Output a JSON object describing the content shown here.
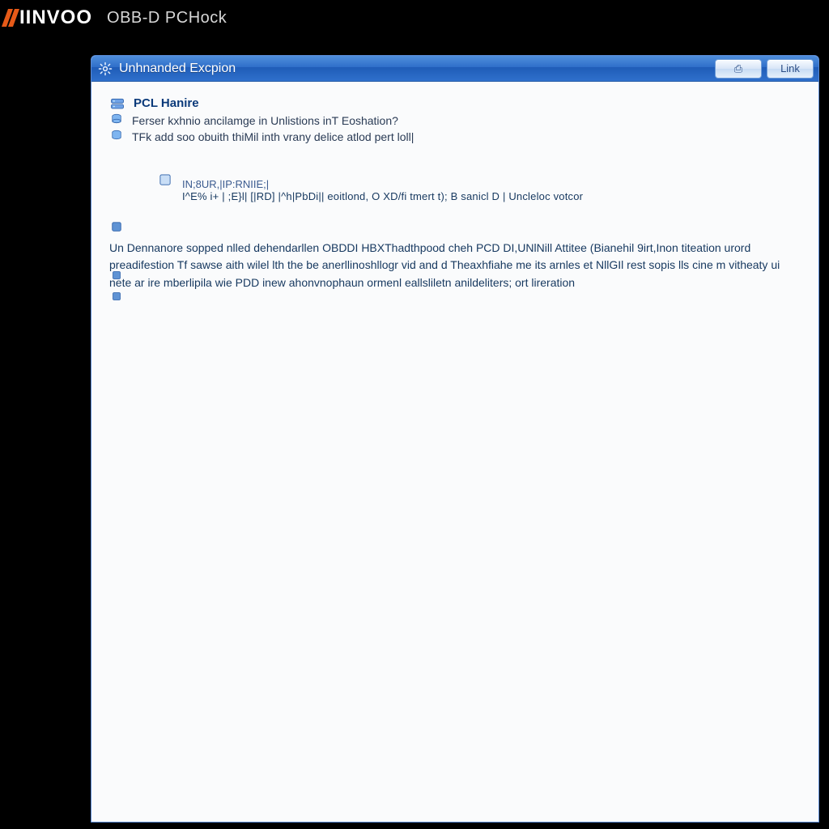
{
  "brand": {
    "name": "IINVOO",
    "subtitle": "OBB-D PCHock"
  },
  "window": {
    "title": "Unhnanded Excpion",
    "btn_action_label": "⎙",
    "btn_link_label": "Link"
  },
  "header": {
    "app_name": "PCL Hanire",
    "line1": "Ferser kxhnio ancilamge in Unlistions inT Eoshation?",
    "line2": "TFk add soo obuith thiMil inth vrany delice atlod pert loll|"
  },
  "detail": {
    "row1": "IN;8UR,|IP:RNIIE;|",
    "row2": "I^E% i+ | ;E}l| [|RD]   |^h|PbDi|| eoitlond,  O XD/fi tmert t);  B  sanicl D | Uncleloc votcor"
  },
  "paragraph": "Un Dennanore sopped nlled dehendarllen OBDDI HBXThadthpood cheh PCD DI,UNlNill Attitee (Bianehil 9irt,Inon titeation urord preadifestion Tf sawse aith wilel lth the be anerllinoshllogr vid and d Theaxhfiahe me its arnles et NllGIl rest sopis lls cine m vitheaty ui nete ar ire mberlipila wie PDD inew ahonvnophaun ormenl eallsliletn anildeliters; ort lireration"
}
